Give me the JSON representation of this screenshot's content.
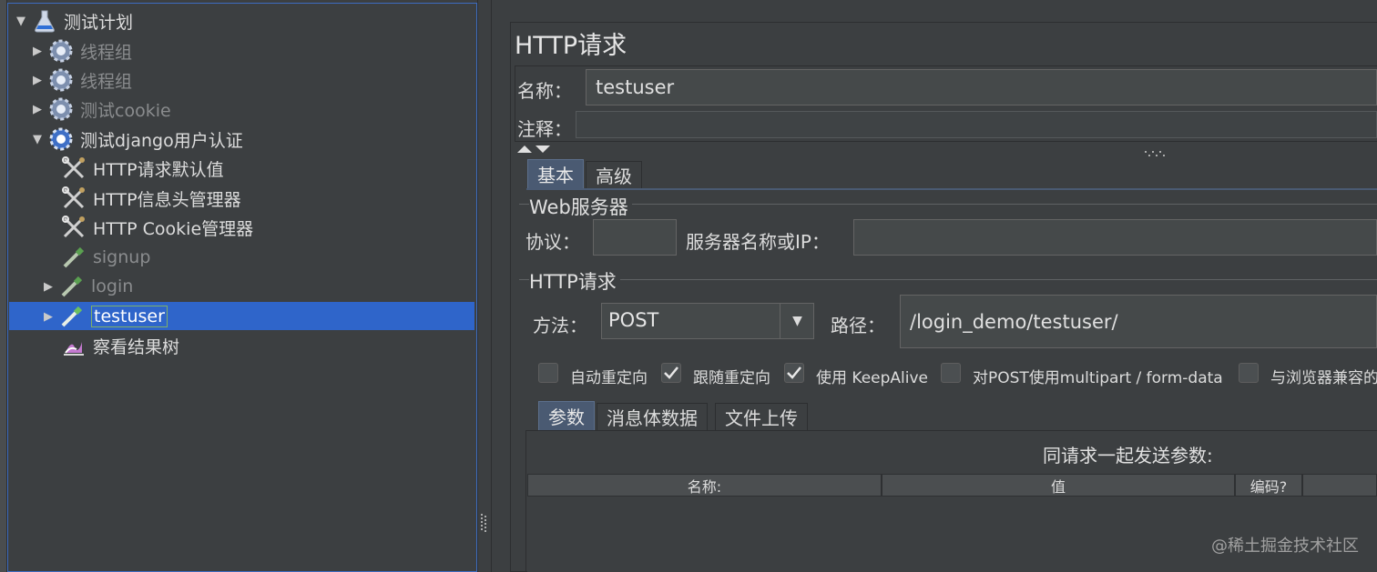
{
  "tree": {
    "items": [
      {
        "label": "测试计划",
        "icon": "flask-icon",
        "expanded": true,
        "enabled": true
      },
      {
        "label": "线程组",
        "icon": "gear-icon",
        "expanded": false,
        "enabled": false
      },
      {
        "label": "线程组",
        "icon": "gear-icon",
        "expanded": false,
        "enabled": false
      },
      {
        "label": "测试cookie",
        "icon": "gear-icon",
        "expanded": false,
        "enabled": false
      },
      {
        "label": "测试django用户认证",
        "icon": "gear-icon",
        "expanded": true,
        "enabled": true
      },
      {
        "label": "HTTP请求默认值",
        "icon": "wrench-scissors-icon",
        "enabled": true
      },
      {
        "label": "HTTP信息头管理器",
        "icon": "wrench-scissors-icon",
        "enabled": true
      },
      {
        "label": "HTTP Cookie管理器",
        "icon": "wrench-scissors-icon",
        "enabled": true
      },
      {
        "label": "signup",
        "icon": "pipette-icon",
        "enabled": false
      },
      {
        "label": "login",
        "icon": "pipette-icon",
        "expanded": false,
        "enabled": false
      },
      {
        "label": "testuser",
        "icon": "pipette-icon",
        "expanded": false,
        "enabled": true,
        "selected": true
      },
      {
        "label": "察看结果树",
        "icon": "chart-icon",
        "enabled": true
      }
    ]
  },
  "panel": {
    "title": "HTTP请求",
    "name_label": "名称：",
    "name_value": "testuser",
    "comment_label": "注释：",
    "comment_value": "",
    "tabs": [
      "基本",
      "高级"
    ],
    "active_tab": "基本"
  },
  "web_server": {
    "title": "Web服务器",
    "protocol_label": "协议：",
    "protocol_value": "",
    "server_label": "服务器名称或IP：",
    "server_value": ""
  },
  "http_request": {
    "title": "HTTP请求",
    "method_label": "方法：",
    "method_value": "POST",
    "path_label": "路径：",
    "path_value": "/login_demo/testuser/",
    "checkboxes": [
      {
        "label": "自动重定向",
        "checked": false
      },
      {
        "label": "跟随重定向",
        "checked": true
      },
      {
        "label": "使用 KeepAlive",
        "checked": true
      },
      {
        "label": "对POST使用multipart / form-data",
        "checked": false
      },
      {
        "label": "与浏览器兼容的",
        "checked": false
      }
    ]
  },
  "params": {
    "tabs": [
      "参数",
      "消息体数据",
      "文件上传"
    ],
    "active_tab": "参数",
    "caption": "同请求一起发送参数:",
    "columns": [
      "名称:",
      "值",
      "编码?"
    ]
  },
  "watermark": "@稀土掘金技术社区",
  "colors": {
    "selection": "#2f65ca",
    "background": "#3c3f41",
    "tab_active": "#4a5a72"
  }
}
